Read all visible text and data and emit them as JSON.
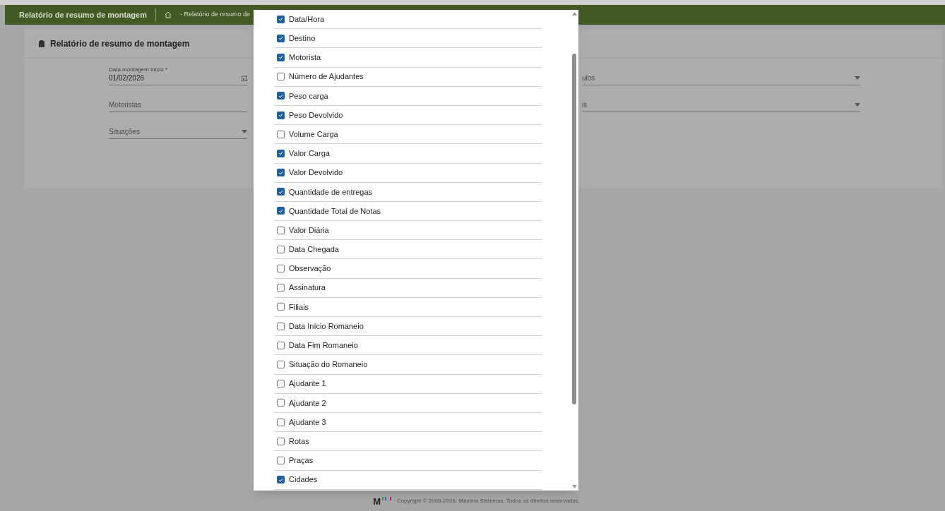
{
  "header": {
    "title": "Relatório de resumo de montagem",
    "breadcrumb": "- Relatório de resumo de"
  },
  "card": {
    "title": "Relatório de resumo de montagem"
  },
  "fields_left": [
    {
      "kind": "date",
      "label": "Data montagem início *",
      "value": "01/02/2026"
    },
    {
      "kind": "text",
      "placeholder": "Motoristas"
    },
    {
      "kind": "select",
      "placeholder": "Situações"
    }
  ],
  "fields_right": [
    {
      "kind": "select",
      "placeholder": "ulos"
    },
    {
      "kind": "select",
      "placeholder": "is"
    }
  ],
  "column_list": [
    {
      "label": "Data/Hora",
      "checked": true
    },
    {
      "label": "Destino",
      "checked": true
    },
    {
      "label": "Motorista",
      "checked": true
    },
    {
      "label": "Número de Ajudantes",
      "checked": false
    },
    {
      "label": "Peso carga",
      "checked": true
    },
    {
      "label": "Peso Devolvido",
      "checked": true
    },
    {
      "label": "Volume Carga",
      "checked": false
    },
    {
      "label": "Valor Carga",
      "checked": true
    },
    {
      "label": "Valor Devolvido",
      "checked": true
    },
    {
      "label": "Quantidade de entregas",
      "checked": true
    },
    {
      "label": "Quantidade Total de Notas",
      "checked": true
    },
    {
      "label": "Valor Diária",
      "checked": false
    },
    {
      "label": "Data Chegada",
      "checked": false
    },
    {
      "label": "Observação",
      "checked": false
    },
    {
      "label": "Assinatura",
      "checked": false
    },
    {
      "label": "Filiais",
      "checked": false
    },
    {
      "label": "Data Início Romaneio",
      "checked": false
    },
    {
      "label": "Data Fim Romaneio",
      "checked": false
    },
    {
      "label": "Situação do Romaneio",
      "checked": false
    },
    {
      "label": "Ajudante 1",
      "checked": false
    },
    {
      "label": "Ajudante 2",
      "checked": false
    },
    {
      "label": "Ajudante 3",
      "checked": false
    },
    {
      "label": "Rotas",
      "checked": false
    },
    {
      "label": "Praças",
      "checked": false
    },
    {
      "label": "Cidades",
      "checked": true
    }
  ],
  "footer": {
    "logo": "M",
    "copyright": "Copyright © 2008-2026. Máxima Sistemas. Todos os direitos reservados."
  }
}
